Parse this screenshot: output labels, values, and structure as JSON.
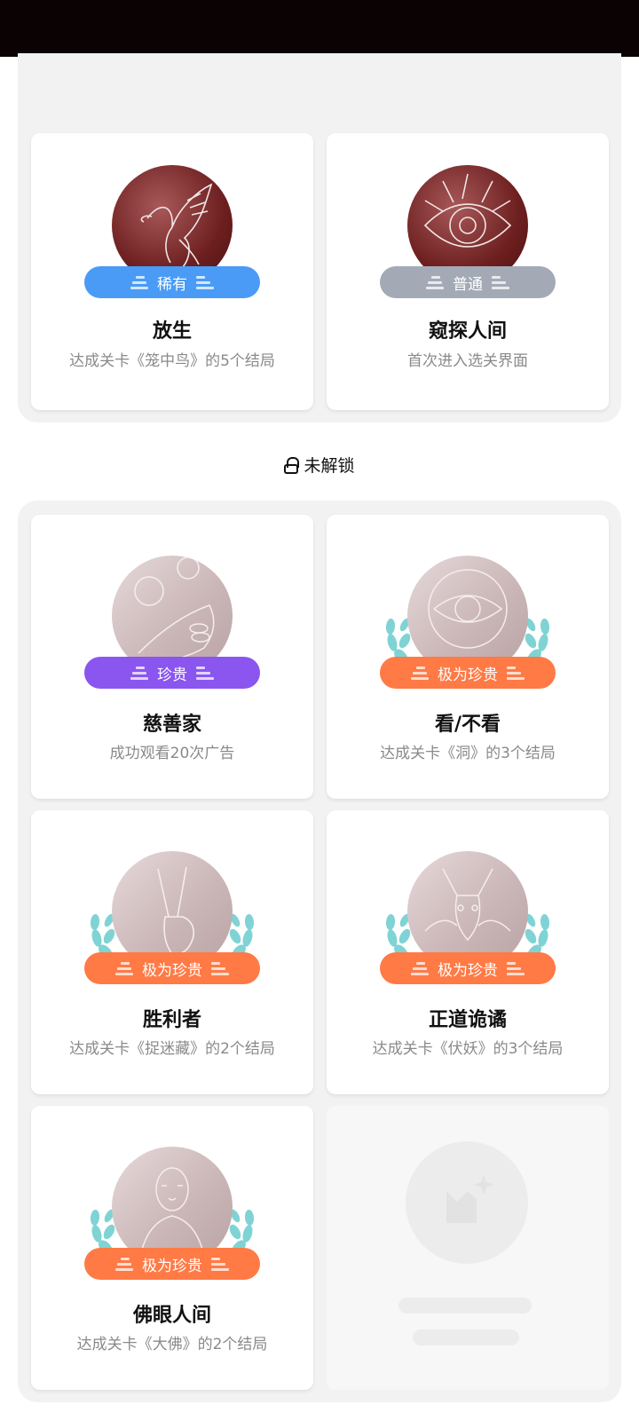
{
  "close_icon": "close-icon",
  "unlocked": [
    {
      "title": "放生",
      "desc": "达成关卡《笼中鸟》的5个结局",
      "rarity": "稀有",
      "rarity_color": "#4a9bf5",
      "art": "bird"
    },
    {
      "title": "窥探人间",
      "desc": "首次进入选关界面",
      "rarity": "普通",
      "rarity_color": "#a3aab5",
      "art": "eye"
    }
  ],
  "locked_section": {
    "label": "未解锁",
    "icon": "lock-icon"
  },
  "locked": [
    {
      "title": "慈善家",
      "desc": "成功观看20次广告",
      "rarity": "珍贵",
      "rarity_color": "#8b55f0",
      "art": "coins"
    },
    {
      "title": "看/不看",
      "desc": "达成关卡《洞》的3个结局",
      "rarity": "极为珍贵",
      "rarity_color": "#ff7a45",
      "art": "eye-sketch"
    },
    {
      "title": "胜利者",
      "desc": "达成关卡《捉迷藏》的2个结局",
      "rarity": "极为珍贵",
      "rarity_color": "#ff7a45",
      "art": "victory-hand"
    },
    {
      "title": "正道诡谲",
      "desc": "达成关卡《伏妖》的3个结局",
      "rarity": "极为珍贵",
      "rarity_color": "#ff7a45",
      "art": "fox"
    },
    {
      "title": "佛眼人间",
      "desc": "达成关卡《大佛》的2个结局",
      "rarity": "极为珍贵",
      "rarity_color": "#ff7a45",
      "art": "buddha"
    }
  ],
  "placeholder": {
    "icon": "image-placeholder-icon"
  }
}
